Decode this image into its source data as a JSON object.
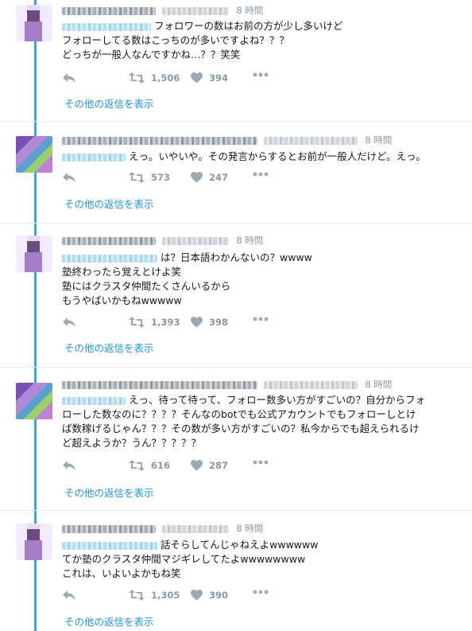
{
  "tweets": [
    {
      "time": "8 時間",
      "body": [
        "フォロワーの数はお前の方が少し多いけど",
        "フォローしてる数はこっちのが多いですよね？？？",
        "どっちが一般人なんですかね…？？笑笑"
      ],
      "retweets": "1,506",
      "likes": "394",
      "more_replies": "その他の返信を表示"
    },
    {
      "time": "8 時間",
      "body": [
        "えっ。いやいや。その発言からするとお前が一般人だけど。えっ。"
      ],
      "retweets": "573",
      "likes": "247",
      "more_replies": "その他の返信を表示"
    },
    {
      "time": "8 時間",
      "body": [
        "は？日本語わかんないの？wwww",
        "塾終わったら覚えとけよ笑",
        "塾にはクラスタ仲間たくさんいるから",
        "もうやばいかもねwwwww"
      ],
      "retweets": "1,393",
      "likes": "398",
      "more_replies": "その他の返信を表示"
    },
    {
      "time": "8 時間",
      "body": [
        "えっ、待って待って、フォロー数多い方がすごいの？自分からフォ",
        "ローした数なのに？？？？そんなのbotでも公式アカウントでもフォローしとけ",
        "ば数稼げるじゃん？？？その数が多い方がすごいの？私今からでも超えられるけ",
        "ど超えようか？うん？？？？？"
      ],
      "retweets": "616",
      "likes": "287",
      "more_replies": "その他の返信を表示"
    },
    {
      "time": "8 時間",
      "body": [
        "話そらしてんじゃねえよwwwwww",
        "てか塾のクラスタ仲間マジギレしてたよwwwwwwww",
        "これは、いよいよかもね笑"
      ],
      "retweets": "1,305",
      "likes": "390",
      "more_replies": "その他の返信を表示"
    }
  ],
  "icons": {
    "reply": "reply-icon",
    "retweet": "retweet-icon",
    "like": "heart-icon",
    "more": "more-icon"
  },
  "colors": {
    "thread_line": "#27b2dd",
    "link": "#1b95e0",
    "muted": "#8899a6"
  }
}
